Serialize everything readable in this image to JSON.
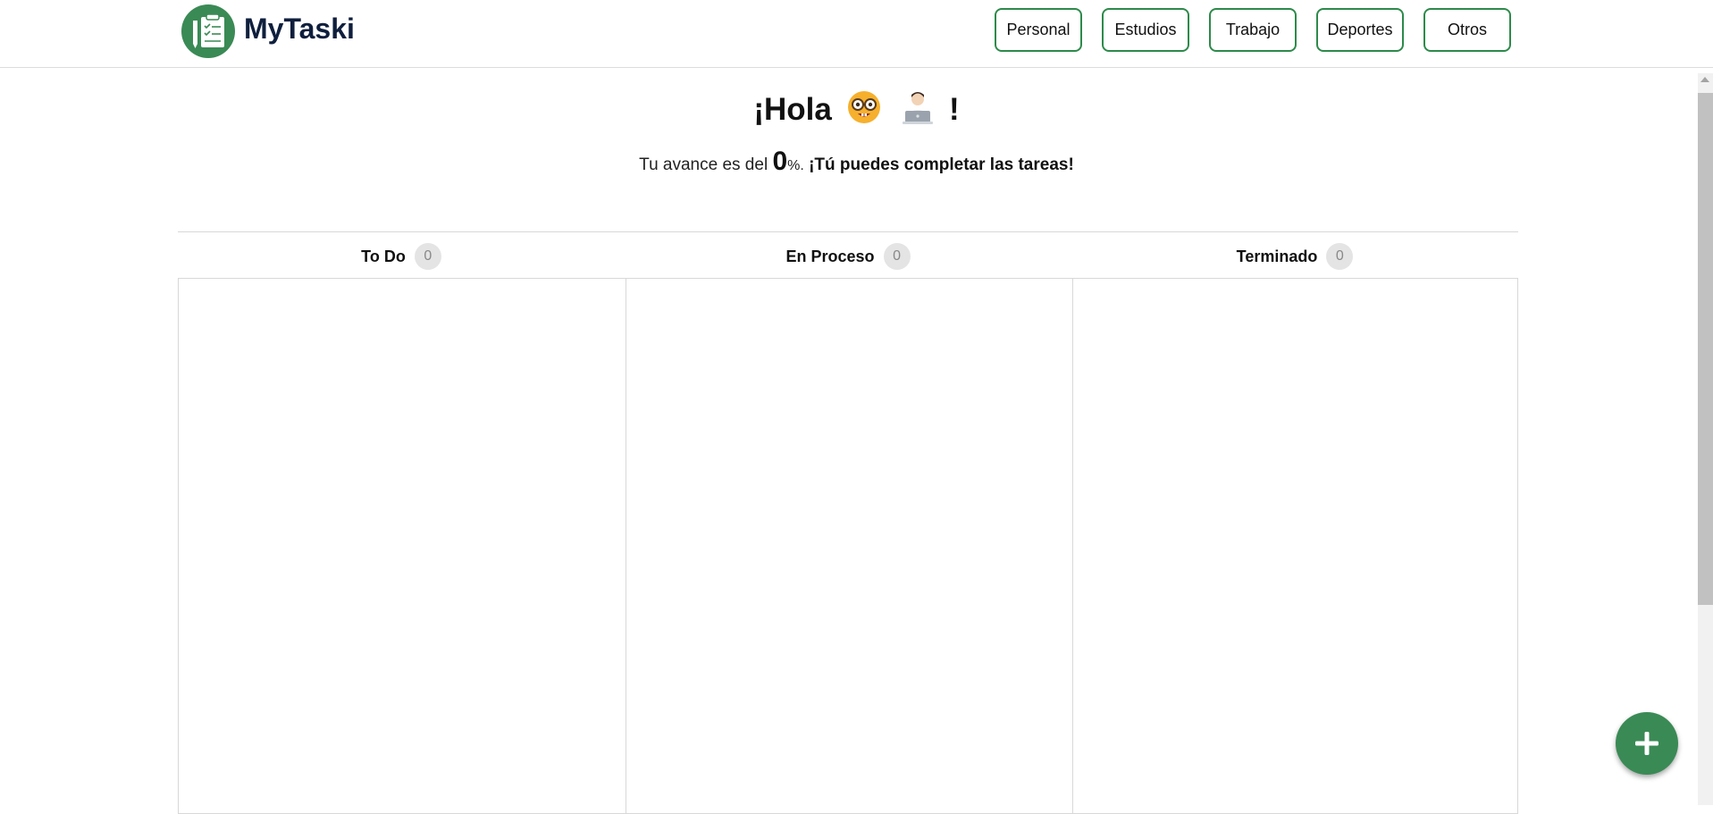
{
  "brand": {
    "name": "MyTaski",
    "logo": "clipboard-pencil-icon",
    "accent": "#3a8a55"
  },
  "categories": [
    {
      "label": "Personal"
    },
    {
      "label": "Estudios"
    },
    {
      "label": "Trabajo"
    },
    {
      "label": "Deportes"
    },
    {
      "label": "Otros"
    }
  ],
  "greeting": {
    "prefix": "¡Hola",
    "emojis": [
      "nerd-face-icon",
      "technologist-icon"
    ],
    "suffix": "!"
  },
  "progress": {
    "before": "Tu avance es del ",
    "value": "0",
    "unit": "%.",
    "encouragement": " ¡Tú puedes completar las tareas!"
  },
  "columns": [
    {
      "title": "To Do",
      "count": "0"
    },
    {
      "title": "En Proceso",
      "count": "0"
    },
    {
      "title": "Terminado",
      "count": "0"
    }
  ],
  "fab": {
    "icon": "plus-icon"
  }
}
